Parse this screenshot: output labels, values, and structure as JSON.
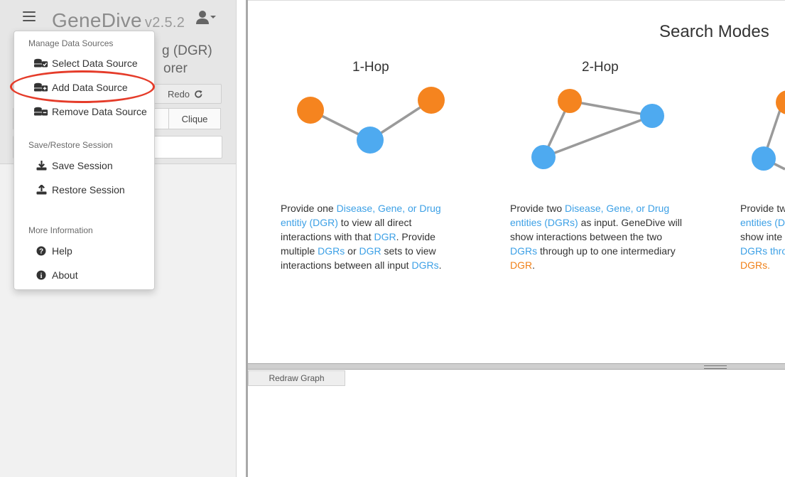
{
  "app": {
    "name": "GeneDive",
    "version": "v2.5.2"
  },
  "left_panel": {
    "subtitle_line1": "g (DGR)",
    "subtitle_line2": "orer",
    "redo_label": "Redo",
    "clique_label": "Clique"
  },
  "menu": {
    "section_data_sources": "Manage Data Sources",
    "select_data_source": "Select Data Source",
    "add_data_source": "Add Data Source",
    "remove_data_source": "Remove Data Source",
    "section_session": "Save/Restore Session",
    "save_session": "Save Session",
    "restore_session": "Restore Session",
    "section_info": "More Information",
    "help": "Help",
    "about": "About"
  },
  "main": {
    "title": "Search Modes",
    "modes": [
      {
        "title": "1-Hop",
        "desc": {
          "t1": "Provide one ",
          "l1": "Disease, Gene, or Drug entitiy (DGR)",
          "t2": " to view all direct interactions with that ",
          "l2": "DGR",
          "t3": ". Provide multiple ",
          "l3": "DGRs",
          "t4": " or ",
          "l4": "DGR",
          "t5": " sets to view interactions between all input ",
          "l5": "DGRs",
          "t6": "."
        }
      },
      {
        "title": "2-Hop",
        "desc": {
          "t1": "Provide two ",
          "l1": "Disease, Gene, or Drug entities (DGRs)",
          "t2": " as input. GeneDive will show interactions between the two ",
          "l2": "DGRs",
          "t3": " through up to one intermediary ",
          "l3": "DGR",
          "t4": "."
        }
      },
      {
        "desc": {
          "line1": "Provide tw",
          "line2": "entities (D",
          "line3": "show inte",
          "line4": "DGRs thro",
          "line5": "DGRs."
        }
      }
    ],
    "redraw_label": "Redraw Graph"
  },
  "colors": {
    "node_orange": "#f5841f",
    "node_blue": "#4eaaf0",
    "edge_gray": "#9a9a9a",
    "highlight_red": "#e53c2a",
    "link_blue": "#3ca0e6"
  },
  "icons": [
    "menu-icon",
    "user-icon",
    "redo-icon",
    "database-check-icon",
    "database-plus-icon",
    "database-minus-icon",
    "download-icon",
    "upload-icon",
    "question-circle-icon",
    "info-circle-icon"
  ]
}
